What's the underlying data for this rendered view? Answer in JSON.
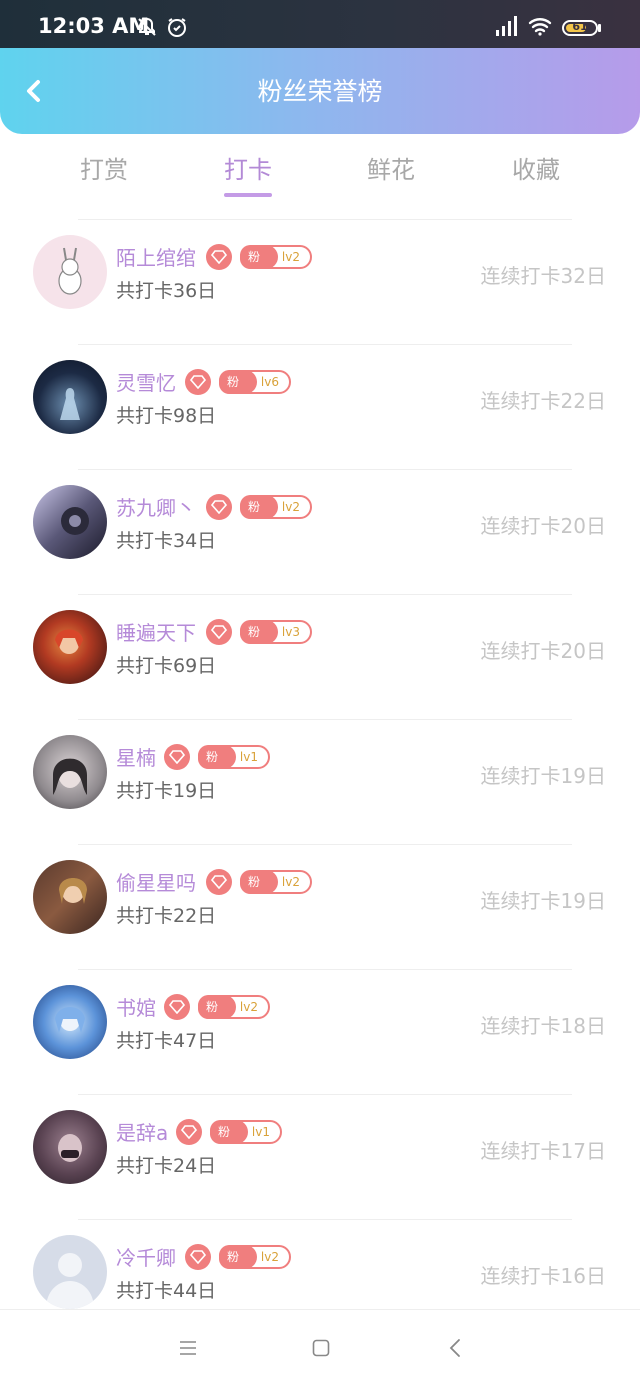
{
  "status_bar": {
    "time": "12:03 AM",
    "battery": "61"
  },
  "header": {
    "title": "粉丝荣誉榜"
  },
  "tabs": [
    {
      "label": "打赏"
    },
    {
      "label": "打卡",
      "active": true
    },
    {
      "label": "鲜花"
    },
    {
      "label": "收藏"
    }
  ],
  "list": [
    {
      "name": "陌上绾绾",
      "badge": "粉",
      "level": "lv2",
      "count": "共打卡36日",
      "streak": "连续打卡32日"
    },
    {
      "name": "灵雪忆",
      "badge": "粉",
      "level": "lv6",
      "count": "共打卡98日",
      "streak": "连续打卡22日"
    },
    {
      "name": "苏九卿丶",
      "badge": "粉",
      "level": "lv2",
      "count": "共打卡34日",
      "streak": "连续打卡20日"
    },
    {
      "name": "睡遍天下",
      "badge": "粉",
      "level": "lv3",
      "count": "共打卡69日",
      "streak": "连续打卡20日"
    },
    {
      "name": "星楠",
      "badge": "粉",
      "level": "lv1",
      "count": "共打卡19日",
      "streak": "连续打卡19日"
    },
    {
      "name": "偷星星吗",
      "badge": "粉",
      "level": "lv2",
      "count": "共打卡22日",
      "streak": "连续打卡19日"
    },
    {
      "name": "书婠",
      "badge": "粉",
      "level": "lv2",
      "count": "共打卡47日",
      "streak": "连续打卡18日"
    },
    {
      "name": "是辞a",
      "badge": "粉",
      "level": "lv1",
      "count": "共打卡24日",
      "streak": "连续打卡17日"
    },
    {
      "name": "冷千卿",
      "badge": "粉",
      "level": "lv2",
      "count": "共打卡44日",
      "streak": "连续打卡16日"
    }
  ]
}
